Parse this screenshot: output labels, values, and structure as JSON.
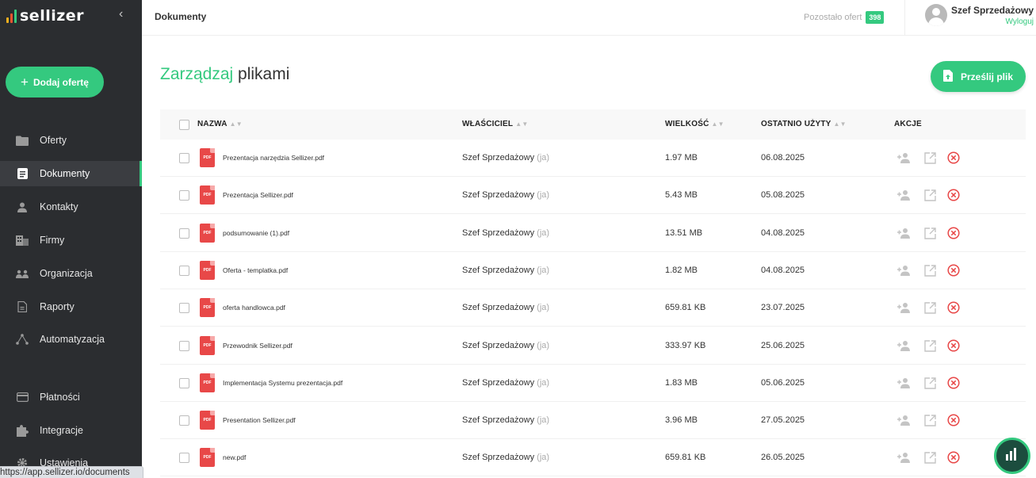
{
  "app": {
    "logo_text": "sellizer",
    "logo_colors": [
      "#f2b01e",
      "#e8542f",
      "#34c97f"
    ],
    "accent_color": "#34c97f"
  },
  "sidebar": {
    "add_offer_label": "Dodaj ofertę",
    "items": [
      {
        "label": "Oferty",
        "icon": "folder-icon",
        "active": false
      },
      {
        "label": "Dokumenty",
        "icon": "document-icon",
        "active": true
      },
      {
        "label": "Kontakty",
        "icon": "person-icon",
        "active": false
      },
      {
        "label": "Firmy",
        "icon": "building-icon",
        "active": false
      },
      {
        "label": "Organizacja",
        "icon": "people-icon",
        "active": false
      },
      {
        "label": "Raporty",
        "icon": "report-icon",
        "active": false
      },
      {
        "label": "Automatyzacja",
        "icon": "automation-icon",
        "active": false
      },
      {
        "label": "Płatności",
        "icon": "credit-card-icon",
        "active": false
      },
      {
        "label": "Integracje",
        "icon": "puzzle-icon",
        "active": false
      },
      {
        "label": "Ustawienia",
        "icon": "gear-icon",
        "active": false
      }
    ]
  },
  "status_bar": {
    "url": "https://app.sellizer.io/documents"
  },
  "header": {
    "breadcrumb": "Dokumenty",
    "offers_left_label": "Pozostało ofert",
    "offers_left_count": "398",
    "user_name": "Szef Sprzedażowy",
    "logout_label": "Wyloguj"
  },
  "main": {
    "title_highlight": "Zarządzaj",
    "title_rest": "plikami",
    "upload_label": "Prześlij plik",
    "columns": {
      "name": "NAZWA",
      "owner": "WŁAŚCICIEL",
      "size": "WIELKOŚĆ",
      "last_used": "OSTATNIO UŻYTY",
      "actions": "AKCJE"
    },
    "owner_me_suffix": "(ja)",
    "pdf_badge": "PDF",
    "files": [
      {
        "name": "Prezentacja narzędzia Sellizer.pdf",
        "owner": "Szef Sprzedażowy",
        "size": "1.97 MB",
        "last_used": "06.08.2025"
      },
      {
        "name": "Prezentacja Sellizer.pdf",
        "owner": "Szef Sprzedażowy",
        "size": "5.43 MB",
        "last_used": "05.08.2025"
      },
      {
        "name": "podsumowanie (1).pdf",
        "owner": "Szef Sprzedażowy",
        "size": "13.51 MB",
        "last_used": "04.08.2025"
      },
      {
        "name": "Oferta - templatka.pdf",
        "owner": "Szef Sprzedażowy",
        "size": "1.82 MB",
        "last_used": "04.08.2025"
      },
      {
        "name": "oferta handlowca.pdf",
        "owner": "Szef Sprzedażowy",
        "size": "659.81 KB",
        "last_used": "23.07.2025"
      },
      {
        "name": "Przewodnik Sellizer.pdf",
        "owner": "Szef Sprzedażowy",
        "size": "333.97 KB",
        "last_used": "25.06.2025"
      },
      {
        "name": "Implementacja Systemu prezentacja.pdf",
        "owner": "Szef Sprzedażowy",
        "size": "1.83 MB",
        "last_used": "05.06.2025"
      },
      {
        "name": "Presentation Sellizer.pdf",
        "owner": "Szef Sprzedażowy",
        "size": "3.96 MB",
        "last_used": "27.05.2025"
      },
      {
        "name": "new.pdf",
        "owner": "Szef Sprzedażowy",
        "size": "659.81 KB",
        "last_used": "26.05.2025"
      }
    ]
  }
}
